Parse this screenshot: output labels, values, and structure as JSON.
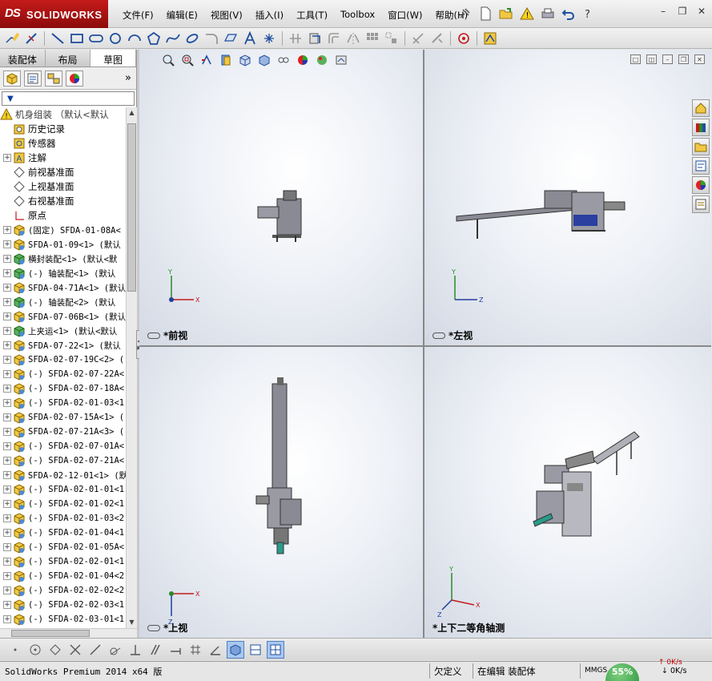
{
  "app": {
    "logo_ds": "DS",
    "logo_text": "SOLIDWORKS",
    "menus": [
      "文件(F)",
      "编辑(E)",
      "视图(V)",
      "插入(I)",
      "工具(T)",
      "Toolbox",
      "窗口(W)",
      "帮助(H)"
    ]
  },
  "tabs": [
    "装配体",
    "布局",
    "草图"
  ],
  "tree": {
    "root": "机身组装 （默认<默认",
    "items": [
      {
        "label": "历史记录",
        "icon": "history-icon",
        "exp": false
      },
      {
        "label": "传感器",
        "icon": "sensor-icon",
        "exp": false
      },
      {
        "label": "注解",
        "icon": "annotation-icon",
        "exp": true
      },
      {
        "label": "前视基准面",
        "icon": "plane-icon",
        "exp": false
      },
      {
        "label": "上视基准面",
        "icon": "plane-icon",
        "exp": false
      },
      {
        "label": "右视基准面",
        "icon": "plane-icon",
        "exp": false
      },
      {
        "label": "原点",
        "icon": "origin-icon",
        "exp": false
      },
      {
        "label": "(固定) SFDA-01-08A<",
        "icon": "component-icon",
        "exp": true
      },
      {
        "label": "SFDA-01-09<1> (默认",
        "icon": "component-icon",
        "exp": true
      },
      {
        "label": "横封装配<1> (默认<默",
        "icon": "subassembly-icon",
        "exp": true
      },
      {
        "label": "(-) 轴装配<1> (默认",
        "icon": "subassembly-icon",
        "exp": true
      },
      {
        "label": "SFDA-04-71A<1> (默认",
        "icon": "component-icon",
        "exp": true
      },
      {
        "label": "(-) 轴装配<2> (默认",
        "icon": "subassembly-icon",
        "exp": true
      },
      {
        "label": "SFDA-07-06B<1> (默认",
        "icon": "component-icon",
        "exp": true
      },
      {
        "label": "上夹运<1> (默认<默认",
        "icon": "subassembly-icon",
        "exp": true
      },
      {
        "label": "SFDA-07-22<1> (默认",
        "icon": "component-icon",
        "exp": true
      },
      {
        "label": "SFDA-02-07-19C<2> (",
        "icon": "component-icon",
        "exp": true
      },
      {
        "label": "(-) SFDA-02-07-22A<",
        "icon": "component-icon",
        "exp": true
      },
      {
        "label": "(-) SFDA-02-07-18A<",
        "icon": "component-icon",
        "exp": true
      },
      {
        "label": "(-) SFDA-02-01-03<1",
        "icon": "component-icon",
        "exp": true
      },
      {
        "label": "SFDA-02-07-15A<1> (",
        "icon": "component-icon",
        "exp": true
      },
      {
        "label": "SFDA-02-07-21A<3> (",
        "icon": "component-icon",
        "exp": true
      },
      {
        "label": "(-) SFDA-02-07-01A<",
        "icon": "component-icon",
        "exp": true
      },
      {
        "label": "(-) SFDA-02-07-21A<",
        "icon": "component-icon",
        "exp": true
      },
      {
        "label": "SFDA-02-12-01<1> (默",
        "icon": "component-icon",
        "exp": true
      },
      {
        "label": "(-) SFDA-02-01-01<1",
        "icon": "component-icon",
        "exp": true
      },
      {
        "label": "(-) SFDA-02-01-02<1",
        "icon": "component-icon",
        "exp": true
      },
      {
        "label": "(-) SFDA-02-01-03<2",
        "icon": "component-icon",
        "exp": true
      },
      {
        "label": "(-) SFDA-02-01-04<1",
        "icon": "component-icon",
        "exp": true
      },
      {
        "label": "(-) SFDA-02-01-05A<",
        "icon": "component-icon",
        "exp": true
      },
      {
        "label": "(-) SFDA-02-02-01<1",
        "icon": "component-icon",
        "exp": true
      },
      {
        "label": "(-) SFDA-02-01-04<2",
        "icon": "component-icon",
        "exp": true
      },
      {
        "label": "(-) SFDA-02-02-02<2",
        "icon": "component-icon",
        "exp": true
      },
      {
        "label": "(-) SFDA-02-02-03<1",
        "icon": "component-icon",
        "exp": true
      },
      {
        "label": "(-) SFDA-02-03-01<1",
        "icon": "component-icon",
        "exp": true
      }
    ]
  },
  "views": {
    "front": "*前视",
    "left": "*左视",
    "top": "*上视",
    "iso": "*上下二等角轴测",
    "axes": {
      "x": "X",
      "y": "Y",
      "z": "Z"
    }
  },
  "status": {
    "product": "SolidWorks Premium 2014 x64 版",
    "defined": "欠定义",
    "editing": "在编辑 装配体",
    "units": "MMGS",
    "net_percent": "55%",
    "net_up": "0K/s",
    "net_down": "0K/s"
  },
  "colors": {
    "brand": "#c41b1b",
    "accent": "#1f4fa0"
  }
}
